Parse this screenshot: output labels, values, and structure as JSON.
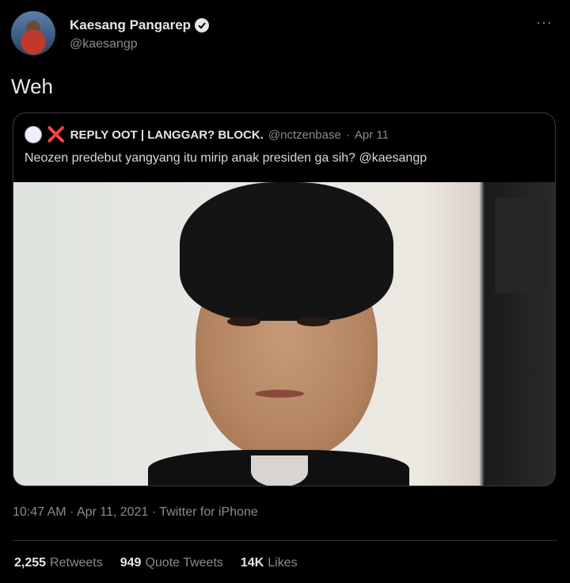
{
  "tweet": {
    "author_name": "Kaesang Pangarep",
    "author_handle": "@kaesangp",
    "more_label": "···",
    "text": "Weh",
    "timestamp": "10:47 AM · Apr 11, 2021 · Twitter for iPhone"
  },
  "quote": {
    "mark": "❌",
    "author_name": "REPLY OOT | LANGGAR? BLOCK.",
    "author_handle": "@nctzenbase",
    "separator": "·",
    "date": "Apr 11",
    "text": "Neozen predebut yangyang itu mirip anak presiden ga sih? @kaesangp"
  },
  "stats": [
    {
      "count": "2,255",
      "label": "Retweets"
    },
    {
      "count": "949",
      "label": "Quote Tweets"
    },
    {
      "count": "14K",
      "label": "Likes"
    }
  ],
  "colors": {
    "background": "#000000",
    "secondary_text": "#8b8b8b",
    "x_mark": "#e0202a"
  },
  "icons": {
    "verified": "verified-badge-icon",
    "more": "more-options-icon"
  }
}
